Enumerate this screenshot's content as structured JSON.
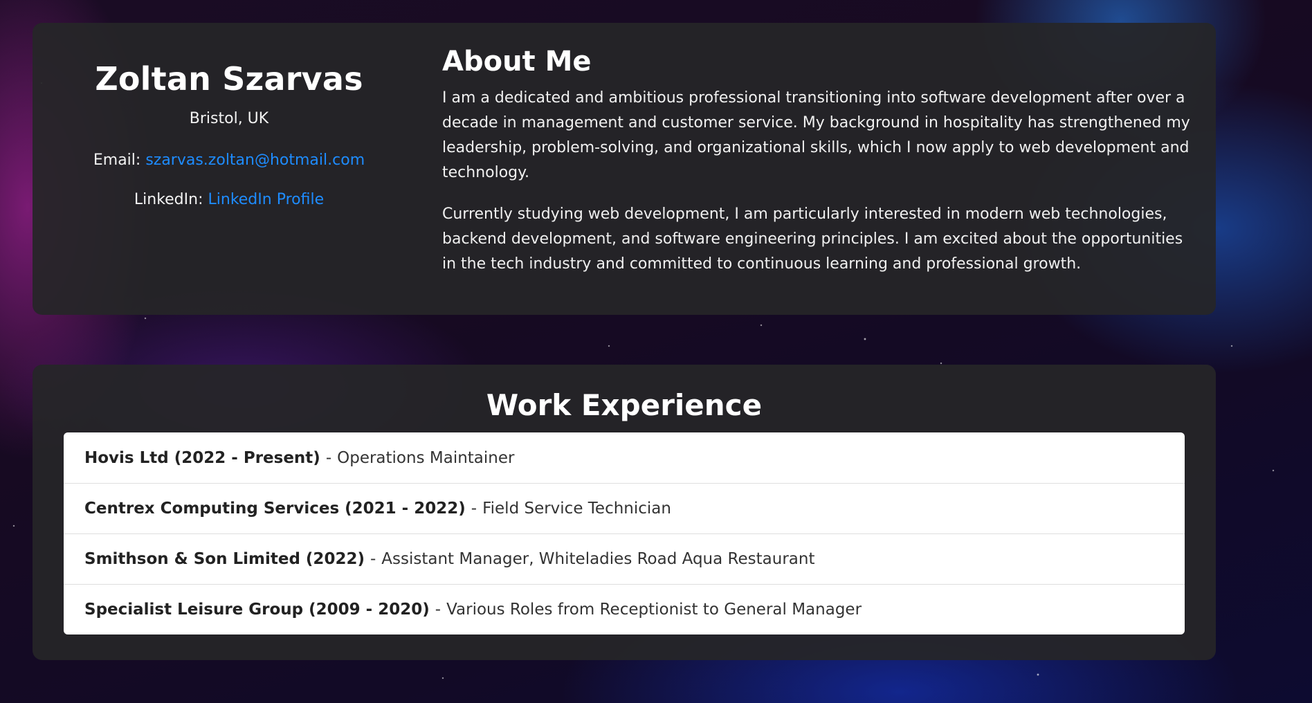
{
  "profile": {
    "name": "Zoltan Szarvas",
    "location": "Bristol, UK",
    "email_label": "Email:",
    "email": "szarvas.zoltan@hotmail.com",
    "linkedin_label": "LinkedIn:",
    "linkedin_link_text": "LinkedIn Profile"
  },
  "about": {
    "heading": "About Me",
    "paragraphs": [
      "I am a dedicated and ambitious professional transitioning into software development after over a decade in management and customer service. My background in hospitality has strengthened my leadership, problem-solving, and organizational skills, which I now apply to web development and technology.",
      "Currently studying web development, I am particularly interested in modern web technologies, backend development, and software engineering principles. I am excited about the opportunities in the tech industry and committed to continuous learning and professional growth."
    ]
  },
  "work": {
    "heading": "Work Experience",
    "separator": "-",
    "jobs": [
      {
        "company": "Hovis Ltd (2022 - Present)",
        "role": "Operations Maintainer"
      },
      {
        "company": "Centrex Computing Services (2021 - 2022)",
        "role": "Field Service Technician"
      },
      {
        "company": "Smithson & Son Limited (2022)",
        "role": "Assistant Manager, Whiteladies Road Aqua Restaurant"
      },
      {
        "company": "Specialist Leisure Group (2009 - 2020)",
        "role": "Various Roles from Receptionist to General Manager"
      }
    ]
  },
  "colors": {
    "link": "#1e8cff",
    "card_background": "#262628",
    "list_background": "#ffffff"
  }
}
